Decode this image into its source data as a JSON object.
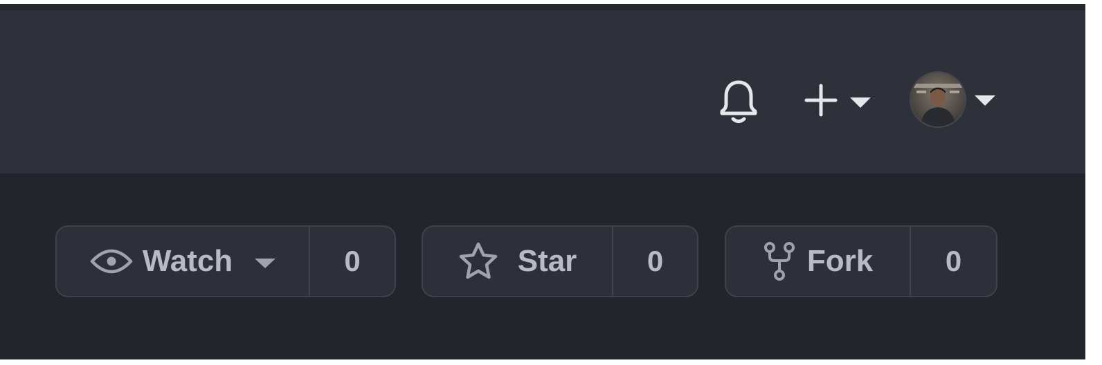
{
  "header": {
    "icons": {
      "notifications": "bell-icon",
      "create": "plus-icon",
      "create_menu": "chevron-down-icon",
      "profile_menu": "chevron-down-icon"
    }
  },
  "repo_actions": {
    "watch": {
      "label": "Watch",
      "count": "0",
      "icon": "eye-icon"
    },
    "star": {
      "label": "Star",
      "count": "0",
      "icon": "star-icon"
    },
    "fork": {
      "label": "Fork",
      "count": "0",
      "icon": "repo-forked-icon"
    }
  },
  "colors": {
    "header_bg": "#2e3139",
    "page_bg": "#22262c",
    "button_bg": "#2d3038",
    "button_border": "#3e424a",
    "button_text": "#b7bbc4",
    "header_icon": "#e6e7ea"
  }
}
